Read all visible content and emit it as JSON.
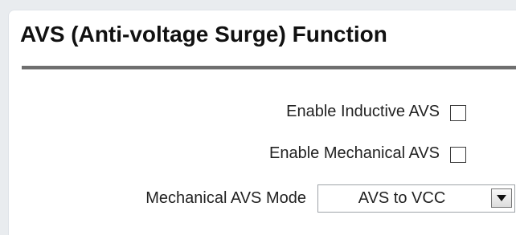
{
  "section": {
    "title": "AVS (Anti-voltage Surge) Function"
  },
  "fields": {
    "inductive_avs": {
      "label": "Enable Inductive AVS",
      "checked": false
    },
    "mechanical_avs": {
      "label": "Enable Mechanical AVS",
      "checked": false
    },
    "mechanical_avs_mode": {
      "label": "Mechanical AVS Mode",
      "value": "AVS to VCC"
    }
  },
  "icons": {
    "dropdown": "chevron-down-icon"
  }
}
